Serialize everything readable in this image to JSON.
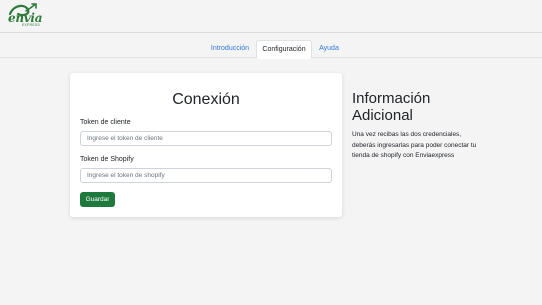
{
  "header": {
    "logo_text": "envia",
    "logo_sub": "EXPRESS"
  },
  "tabs": [
    {
      "label": "Introducción",
      "active": false
    },
    {
      "label": "Configuración",
      "active": true
    },
    {
      "label": "Ayuda",
      "active": false
    }
  ],
  "form": {
    "title": "Conexión",
    "client_token_label": "Token de cliente",
    "client_token_placeholder": "Ingrese el token de cliente",
    "shopify_token_label": "Token de Shopify",
    "shopify_token_placeholder": "Ingrese el token de shopify",
    "save_label": "Guardar"
  },
  "info": {
    "title": "Información Adicional",
    "text": "Una vez recibas las dos credenciales, deberás ingresarlas para poder conectar tu tienda de shopify con Enviaexpress"
  },
  "colors": {
    "accent": "#1e7a3c",
    "link": "#2f7bd6",
    "background": "#f4f4f5"
  }
}
